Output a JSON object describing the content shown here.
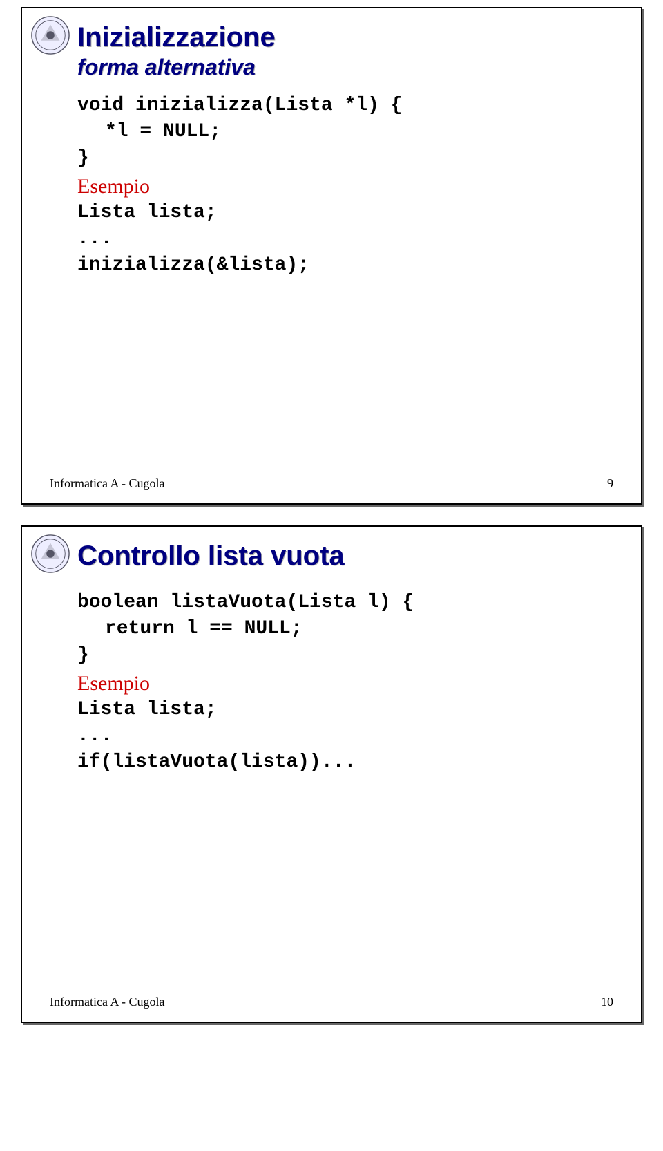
{
  "slide1": {
    "title": "Inizializzazione",
    "subtitle": "forma alternativa",
    "code_line1": "void inizializza(Lista *l) {",
    "code_line2": "*l = NULL;",
    "code_line3": "}",
    "example_label": "Esempio",
    "code_line4": "Lista lista;",
    "code_line5": "...",
    "code_line6": "inizializza(&lista);",
    "footer_left": "Informatica A - Cugola",
    "footer_right": "9"
  },
  "slide2": {
    "title": "Controllo lista vuota",
    "code_line1": "boolean listaVuota(Lista l) {",
    "code_line2": "return l == NULL;",
    "code_line3": "}",
    "example_label": "Esempio",
    "code_line4": "Lista lista;",
    "code_line5": "...",
    "code_line6": "if(listaVuota(lista))...",
    "footer_left": "Informatica A - Cugola",
    "footer_right": "10"
  }
}
